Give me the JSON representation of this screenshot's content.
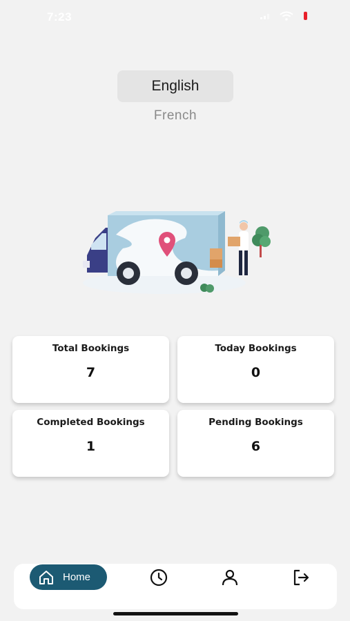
{
  "status_bar": {
    "time": "7:23",
    "icons": [
      "signal-icon",
      "wifi-icon",
      "battery-icon"
    ],
    "battery_color": "#e8202a"
  },
  "language": {
    "options": [
      "English",
      "French"
    ],
    "selected": "English"
  },
  "illustration": {
    "icon": "delivery-truck-illustration"
  },
  "stats": [
    {
      "label": "Total Bookings",
      "value": "7"
    },
    {
      "label": "Today Bookings",
      "value": "0"
    },
    {
      "label": "Completed Bookings",
      "value": "1"
    },
    {
      "label": "Pending Bookings",
      "value": "6"
    }
  ],
  "bottom_nav": {
    "items": [
      {
        "label": "Home",
        "icon": "home-icon",
        "active": true
      },
      {
        "label": "",
        "icon": "clock-icon",
        "active": false
      },
      {
        "label": "",
        "icon": "user-icon",
        "active": false
      },
      {
        "label": "",
        "icon": "logout-icon",
        "active": false
      }
    ],
    "active_color": "#1c5a73"
  }
}
